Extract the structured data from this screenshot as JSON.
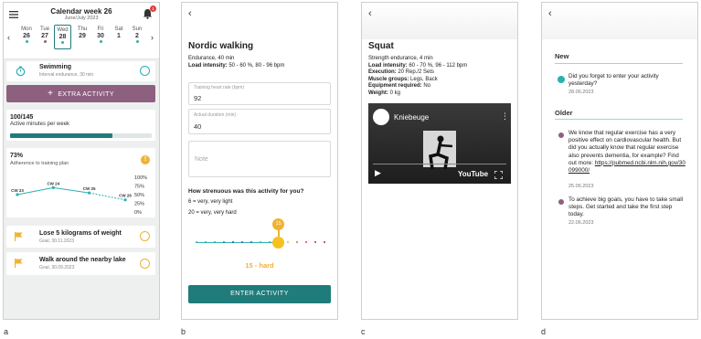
{
  "colors": {
    "teal": "#1f7c7b",
    "accent_teal": "#2ab0b3",
    "purple": "#8e6080",
    "orange": "#f0b232",
    "red": "#e0403a"
  },
  "panel_labels": [
    "a",
    "b",
    "c",
    "d"
  ],
  "panel_a": {
    "title": "Calendar week 26",
    "subtitle": "June/July 2023",
    "notification_count": "1",
    "days": [
      {
        "name": "Mon",
        "num": "26"
      },
      {
        "name": "Tue",
        "num": "27"
      },
      {
        "name": "Wed",
        "num": "28"
      },
      {
        "name": "Thu",
        "num": "29"
      },
      {
        "name": "Fri",
        "num": "30"
      },
      {
        "name": "Sat",
        "num": "1"
      },
      {
        "name": "Sun",
        "num": "2"
      }
    ],
    "activity": {
      "title": "Swimming",
      "subtitle": "Interval endurance, 30 min"
    },
    "extra_button": "EXTRA ACTIVITY",
    "minutes": {
      "value": "100/145",
      "label": "Active minutes per week",
      "progress": 0.72
    },
    "adherence": {
      "value": "73%",
      "label": "Adherence to training plan"
    },
    "chart_data": {
      "type": "line",
      "categories": [
        "CW 23",
        "CW 24",
        "CW 25",
        "CW 26"
      ],
      "values": [
        50,
        70,
        55,
        35
      ],
      "ytick_labels": [
        "100%",
        "75%",
        "50%",
        "25%",
        "0%"
      ],
      "ylim": [
        0,
        100
      ]
    },
    "goals": [
      {
        "title": "Lose 5 kilograms of weight",
        "subtitle": "Goal, 30.11.2023"
      },
      {
        "title": "Walk around the nearby lake",
        "subtitle": "Goal, 30.09.2023"
      }
    ]
  },
  "panel_b": {
    "title": "Nordic walking",
    "line1": "Endurance, 40 min",
    "intensity_label": "Load intensity:",
    "intensity_value": "50 - 60 %, 80 - 96 bpm",
    "hr_label": "Training heart rate (bpm)",
    "hr_value": "92",
    "duration_label": "Actual duration (min)",
    "duration_value": "40",
    "note_placeholder": "Note",
    "question": "How strenuous was this activity for you?",
    "scale_low": "6 = very, very light",
    "scale_high": "20 = very, very hard",
    "slider_value": "15",
    "slider_fraction": 0.64,
    "result": "15 - hard",
    "button": "ENTER ACTIVITY"
  },
  "panel_c": {
    "title": "Squat",
    "line1": "Strength endurance, 4 min",
    "rows": [
      {
        "label": "Load intensity:",
        "value": "60 - 70 %, 96 - 112 bpm"
      },
      {
        "label": "Execution:",
        "value": "20 Rep./2 Sets"
      },
      {
        "label": "Muscle groups:",
        "value": "Legs, Back"
      },
      {
        "label": "Equipment required:",
        "value": "No"
      },
      {
        "label": "Weight:",
        "value": "0 kg"
      }
    ],
    "video_title": "Kniebeuge",
    "video_brand": "YouTube"
  },
  "panel_d": {
    "new_label": "New",
    "older_label": "Older",
    "messages_new": [
      {
        "text": "Did you forget to enter your activity yesterday?",
        "date": "28.06.2023"
      }
    ],
    "messages_older": [
      {
        "text": "We know that regular exercise has a very positive effect on cardiovascular health. But did you actually know that regular exercise also prevents dementia, for example? Find out more:",
        "link": "https://pubmed.ncbi.nlm.nih.gov/30099000/",
        "date": "25.06.2023"
      },
      {
        "text": "To achieve big goals, you have to take small steps. Get started and take the first step today.",
        "date": "22.06.2023"
      }
    ]
  }
}
